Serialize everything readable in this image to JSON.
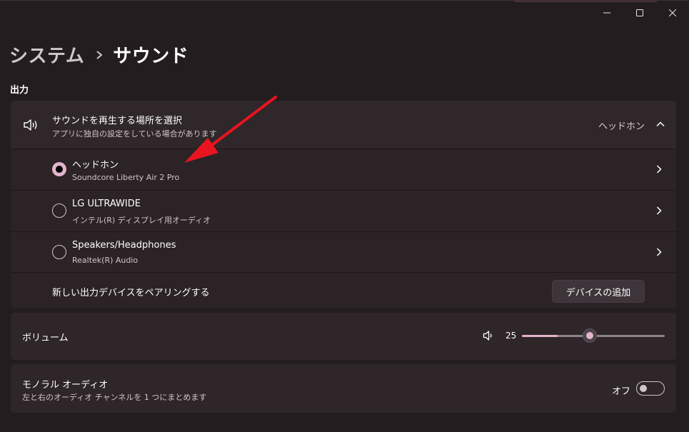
{
  "window_controls": {
    "minimize_icon": "minimize-icon",
    "maximize_icon": "maximize-icon",
    "close_icon": "close-icon"
  },
  "breadcrumb": {
    "parent": "システム",
    "separator_icon": "chevron-right-icon",
    "current": "サウンド"
  },
  "output": {
    "section_label": "出力",
    "header": {
      "icon": "speaker-icon",
      "title": "サウンドを再生する場所を選択",
      "subtitle": "アプリに独自の設定をしている場合があります",
      "current_device": "ヘッドホン",
      "expand_icon": "chevron-up-icon"
    },
    "devices": [
      {
        "name": "ヘッドホン",
        "detail": "Soundcore Liberty Air 2 Pro",
        "selected": true
      },
      {
        "name": "LG ULTRAWIDE",
        "detail": "インテル(R) ディスプレイ用オーディオ",
        "selected": false
      },
      {
        "name": "Speakers/Headphones",
        "detail": "Realtek(R) Audio",
        "selected": false
      }
    ],
    "pair": {
      "label": "新しい出力デバイスをペアリングする",
      "button": "デバイスの追加"
    }
  },
  "volume": {
    "label": "ボリューム",
    "icon": "volume-icon",
    "value": "25",
    "level_percent": 25
  },
  "mono_audio": {
    "title": "モノラル オーディオ",
    "subtitle": "左と右のオーディオ チャンネルを 1 つにまとめます",
    "state_label": "オフ",
    "enabled": false
  },
  "colors": {
    "accent": "#e3b4cd",
    "annotation_arrow": "#e8141f",
    "background": "#241d20",
    "card": "#2e2629"
  }
}
